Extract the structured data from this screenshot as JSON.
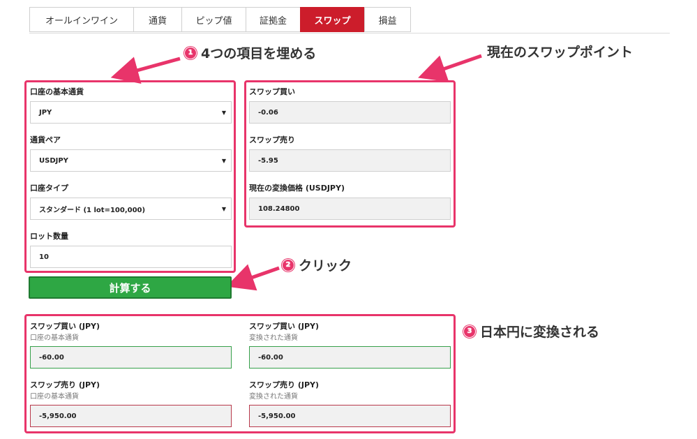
{
  "tabs": [
    "オールインワイン",
    "通貨",
    "ピップ値",
    "証拠金",
    "スワップ",
    "損益"
  ],
  "active_tab": "スワップ",
  "annotations": {
    "step1": "4つの項目を埋める",
    "step1_num": "1",
    "current_swap": "現在のスワップポイント",
    "step2": "クリック",
    "step2_num": "2",
    "step3": "日本円に変換される",
    "step3_num": "3"
  },
  "inputs": {
    "base_currency_label": "口座の基本通貨",
    "base_currency_value": "JPY",
    "pair_label": "通貨ペア",
    "pair_value": "USDJPY",
    "account_type_label": "口座タイプ",
    "account_type_value": "スタンダード (1 lot=100,000)",
    "lot_label": "ロット数量",
    "lot_value": "10"
  },
  "current": {
    "swap_buy_label": "スワップ買い",
    "swap_buy_value": "-0.06",
    "swap_sell_label": "スワップ売り",
    "swap_sell_value": "-5.95",
    "rate_label": "現在の変換価格 (USDJPY)",
    "rate_value": "108.24800"
  },
  "calc_button": "計算する",
  "results": {
    "buy_base_label": "スワップ買い (JPY)",
    "buy_base_sub": "口座の基本通貨",
    "buy_base_value": "-60.00",
    "buy_conv_label": "スワップ買い (JPY)",
    "buy_conv_sub": "変換された通貨",
    "buy_conv_value": "-60.00",
    "sell_base_label": "スワップ売り (JPY)",
    "sell_base_sub": "口座の基本通貨",
    "sell_base_value": "-5,950.00",
    "sell_conv_label": "スワップ売り (JPY)",
    "sell_conv_sub": "変換された通貨",
    "sell_conv_value": "-5,950.00"
  },
  "colors": {
    "active_tab": "#cc1d2b",
    "annotation_pink": "#e8346a",
    "button_green": "#2ea744"
  }
}
